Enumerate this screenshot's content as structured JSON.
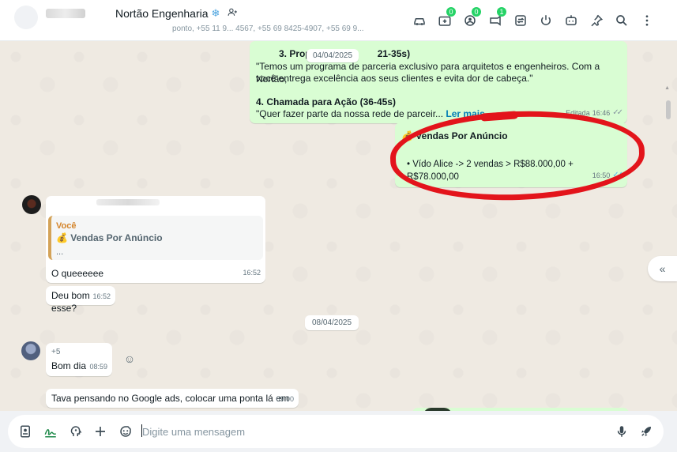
{
  "header": {
    "contact_name": "Nortão Engenharia",
    "snow": "❄",
    "subtitle": "ponto, +55 11 9... 4567, +55 69 8425-4907, +55 69 9...",
    "badges": {
      "communities": "0",
      "status": "0",
      "channels": "1"
    }
  },
  "messages": {
    "date_overlay": "04/04/2025",
    "m1": {
      "l1_prefix": "3. Proposta",
      "l1_suffix": "21-35s)",
      "l2": "\"Temos um programa de parceria exclusivo para arquitetos e engenheiros. Com a Nortão,",
      "l3": "você entrega excelência aos seus clientes e evita dor de cabeça.\"",
      "l4": "4. Chamada para Ação (36-45s)",
      "l5": "\"Quer fazer parte da nossa rede de parceir...",
      "read_more": "Ler mais",
      "edited": "Editada",
      "time": "16:46"
    },
    "m2": {
      "emoji": "💰",
      "title": "Vendas Por Anúncio",
      "line": "• Vído Alice -> 2 vendas > R$88.000,00 + R$78.000,00",
      "time": "16:50"
    },
    "m3": {
      "quote_author": "Você",
      "quote_emoji": "💰",
      "quote_title": "Vendas Por Anúncio",
      "quote_ellipsis": "...",
      "text": "O queeeeee",
      "time": "16:52"
    },
    "m4": {
      "text": "Deu bom esse?",
      "time": "16:52"
    },
    "date_chip": "08/04/2025",
    "m5": {
      "sender": "+5",
      "text": "Bom dia",
      "time": "08:59"
    },
    "m6": {
      "text": "Tava pensando no Google ads, colocar uma ponta lá em",
      "time": "09:00"
    }
  },
  "composer": {
    "placeholder": "Digite uma mensagem"
  }
}
